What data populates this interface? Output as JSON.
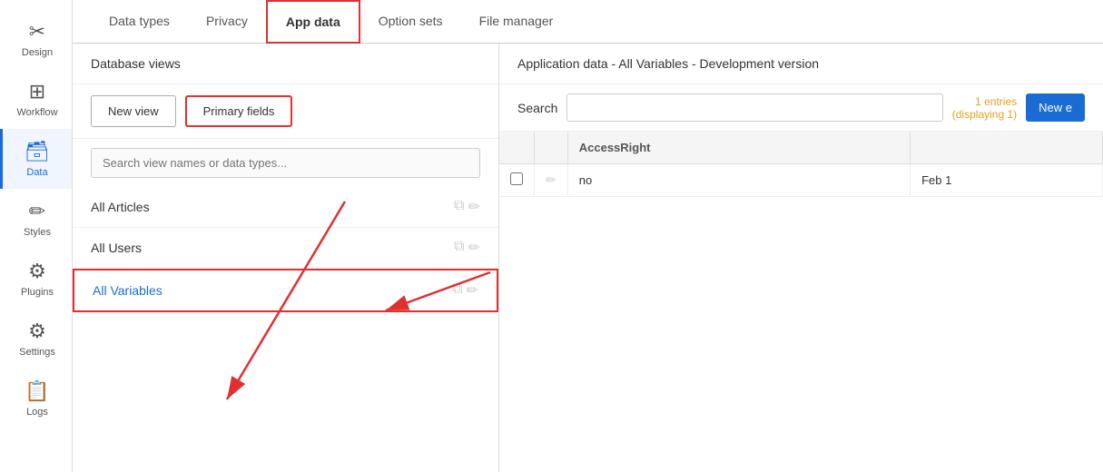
{
  "sidebar": {
    "items": [
      {
        "id": "design",
        "label": "Design",
        "icon": "scissors-icon",
        "active": false
      },
      {
        "id": "workflow",
        "label": "Workflow",
        "icon": "workflow-icon",
        "active": false
      },
      {
        "id": "data",
        "label": "Data",
        "icon": "data-icon",
        "active": true
      },
      {
        "id": "styles",
        "label": "Styles",
        "icon": "styles-icon",
        "active": false
      },
      {
        "id": "plugins",
        "label": "Plugins",
        "icon": "plugins-icon",
        "active": false
      },
      {
        "id": "settings",
        "label": "Settings",
        "icon": "settings-icon",
        "active": false
      },
      {
        "id": "logs",
        "label": "Logs",
        "icon": "logs-icon",
        "active": false
      }
    ]
  },
  "tabs": [
    {
      "id": "data-types",
      "label": "Data types",
      "active": false
    },
    {
      "id": "privacy",
      "label": "Privacy",
      "active": false
    },
    {
      "id": "app-data",
      "label": "App data",
      "active": true
    },
    {
      "id": "option-sets",
      "label": "Option sets",
      "active": false
    },
    {
      "id": "file-manager",
      "label": "File manager",
      "active": false
    }
  ],
  "left_panel": {
    "header": "Database views",
    "new_view_label": "New view",
    "primary_fields_label": "Primary fields",
    "search_placeholder": "Search view names or data types...",
    "views": [
      {
        "id": "all-articles",
        "name": "All Articles",
        "active": false
      },
      {
        "id": "all-users",
        "name": "All Users",
        "active": false
      },
      {
        "id": "all-variables",
        "name": "All Variables",
        "active": true
      }
    ]
  },
  "right_panel": {
    "header": "Application data - All Variables - Development version",
    "search_label": "Search",
    "search_placeholder": "",
    "entries_line1": "1 entries",
    "entries_line2": "(displaying 1)",
    "new_entry_label": "New e",
    "table": {
      "columns": [
        {
          "id": "checkbox",
          "label": ""
        },
        {
          "id": "edit",
          "label": ""
        },
        {
          "id": "access-right",
          "label": "AccessRight"
        },
        {
          "id": "date",
          "label": ""
        }
      ],
      "rows": [
        {
          "checkbox": false,
          "value": "no",
          "access_right": "",
          "date": "Feb 1"
        }
      ]
    }
  }
}
